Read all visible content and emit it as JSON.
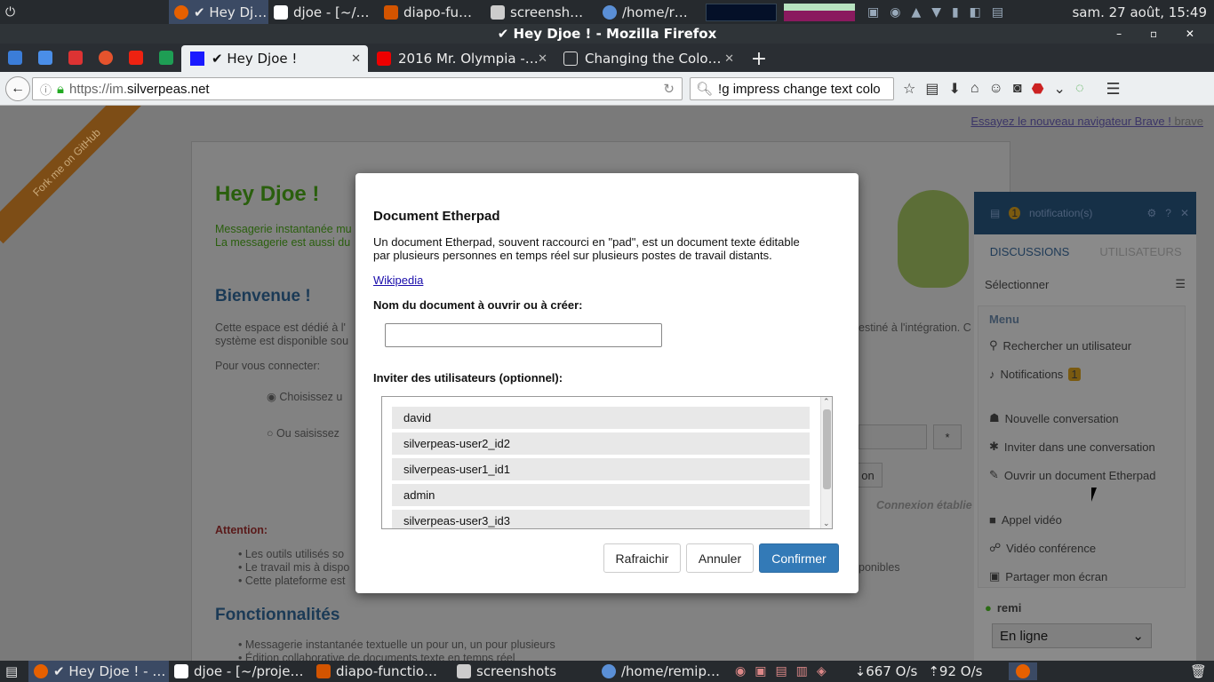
{
  "topbar": {
    "items": [
      {
        "label": "✔ Hey Dj…",
        "icon": "firefox-icon",
        "active": true
      },
      {
        "label": "djoe - [~/…",
        "icon": "intellij-icon"
      },
      {
        "label": "diapo-fu…",
        "icon": "impress-icon"
      },
      {
        "label": "screensh…",
        "icon": "folder-icon"
      },
      {
        "label": "/home/r…",
        "icon": "terminal-icon"
      }
    ],
    "clock": "sam. 27 août, 15:49"
  },
  "window": {
    "title": "✔ Hey Djoe ! - Mozilla Firefox"
  },
  "tabs": [
    {
      "label": "✔ Hey Djoe !",
      "selected": true
    },
    {
      "label": "2016 Mr. Olympia -…",
      "selected": false
    },
    {
      "label": "Changing the Colo…",
      "selected": false
    }
  ],
  "address": {
    "scheme": "https://im.",
    "host": "silverpeas.net"
  },
  "search": {
    "value": "!g impress change text colo"
  },
  "page": {
    "ribbon": "Fork me on GitHub",
    "brave_link": "Essayez le nouveau navigateur Brave !",
    "brave_logo": "brave",
    "title": "Hey Djoe !",
    "intro1": "Messagerie instantanée mu",
    "intro2": "La messagerie est aussi du",
    "welcome": "Bienvenue !",
    "welcome_text1": "Cette espace est dédié à l'",
    "welcome_text2": "système est disponible sou",
    "welcome_right": "estiné à l'intégration. C",
    "connect": "Pour vous connecter:",
    "radio1": "Choisissez u",
    "radio2": "Ou saisissez",
    "star": "*",
    "connect_btn": "on",
    "status": "Connexion établie",
    "attention": "Attention:",
    "bullets": [
      "Les outils utilisés so",
      "Le travail mis à dispo",
      "Cette plateforme est"
    ],
    "bullet_right": "ponibles",
    "features": "Fonctionnalités",
    "features_items": [
      "Messagerie instantanée textuelle un pour un, un pour plusieurs",
      "Édition collaborative de documents texte en temps réel"
    ]
  },
  "chat": {
    "notif_count": "1",
    "notif_label": "notification(s)",
    "tab_discussions": "DISCUSSIONS",
    "tab_users": "UTILISATEURS",
    "select": "Sélectionner",
    "menu_title": "Menu",
    "items": [
      "Rechercher un utilisateur",
      "Notifications",
      "Nouvelle conversation",
      "Inviter dans une conversation",
      "Ouvrir un document Etherpad",
      "Appel vidéo",
      "Vidéo conférence",
      "Partager mon écran"
    ],
    "notif_badge": "1",
    "user": "remi",
    "presence": "En ligne"
  },
  "dialog": {
    "title": "Document Etherpad",
    "description": "Un document Etherpad, souvent raccourci en \"pad\", est un document texte éditable par plusieurs personnes en temps réel sur plusieurs postes de travail distants.",
    "wiki_link": "Wikipedia",
    "name_label": "Nom du document à ouvrir ou à créer:",
    "name_value": "",
    "invite_label": "Inviter des utilisateurs (optionnel):",
    "users": [
      "david",
      "silverpeas-user2_id2",
      "silverpeas-user1_id1",
      "admin",
      "silverpeas-user3_id3"
    ],
    "btn_refresh": "Rafraichir",
    "btn_cancel": "Annuler",
    "btn_confirm": "Confirmer"
  },
  "taskbar": {
    "items": [
      {
        "label": "✔ Hey Djoe ! - …",
        "active": true
      },
      {
        "label": "djoe - [~/proje…"
      },
      {
        "label": "diapo-functio…"
      },
      {
        "label": "screenshots"
      },
      {
        "label": "/home/remip…"
      }
    ],
    "net_down": "667 O/s",
    "net_up": "92 O/s"
  },
  "colors": {
    "accent": "#337ab7",
    "page_title": "#2a5f0d",
    "heading": "#1b3a56"
  }
}
